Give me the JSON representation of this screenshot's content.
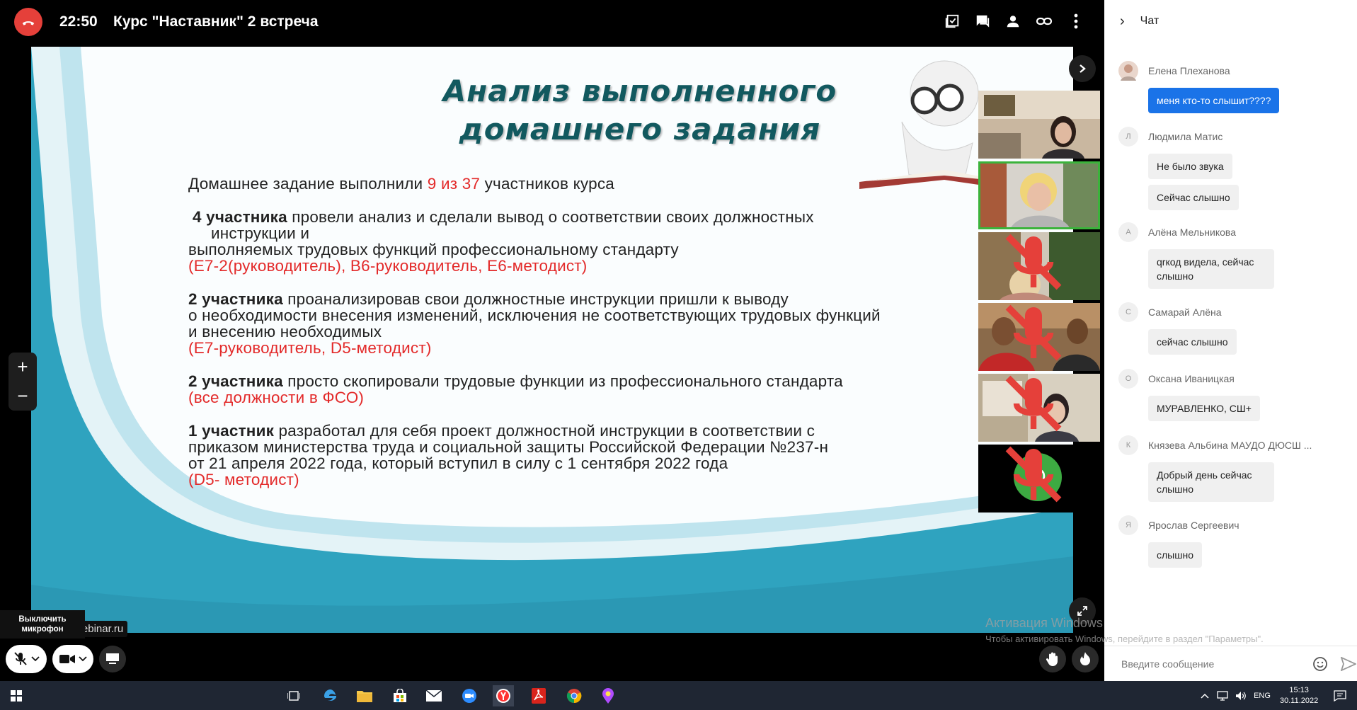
{
  "topbar": {
    "time": "22:50",
    "title": "Курс \"Наставник\" 2 встреча"
  },
  "slide": {
    "title_line1": "Анализ выполненного",
    "title_line2": "домашнего задания",
    "p1_text_a": "Домашнее задание выполнили ",
    "p1_count": "9",
    "p1_of": " из ",
    "p1_total": "37",
    "p1_text_b": " участников курса",
    "p2_bold": "4 участника",
    "p2_line1": " провели анализ  и сделали вывод о соответствии своих должностных",
    "p2_line2": "инструкции  и",
    "p2_line3": "выполняемых трудовых функций  профессиональному стандарту",
    "p2_red": "(Е7-2(руководитель), В6-руководитель, Е6-методист)",
    "p3_bold": "2 участника",
    "p3_line1": " проанализировав свои должностные инструкции пришли к выводу",
    "p3_line2": "о необходимости внесения изменений, исключения не соответствующих трудовых функций",
    "p3_line3": "и внесению необходимых",
    "p3_red": "(Е7-руководитель, D5-методист)",
    "p4_bold": "2 участника",
    "p4_line1": " просто скопировали трудовые функции из профессионального стандарта",
    "p4_red": "(все должности  в ФСО)",
    "p5_bold": "1 участник",
    "p5_line1": " разработал для себя  проект должностной инструкции  в соответствии с",
    "p5_line2": "приказом министерства труда и социальной защиты Российской Федерации №237-н",
    "p5_line3": "от 21 апреля 2022 года, который вступил в силу с 1 сентября 2022 года",
    "p5_red": "(D5- методист)"
  },
  "participants": {
    "avatar_letter": "О"
  },
  "controls": {
    "tooltip_line1": "Выключить",
    "tooltip_line2": "микрофон",
    "brand": "Webinar.ru"
  },
  "chat": {
    "title": "Чат",
    "messages": [
      {
        "initial": "",
        "author": "Елена Плеханова",
        "texts": [
          "меня кто-то слышит????"
        ]
      },
      {
        "initial": "Л",
        "author": "Людмила Матис",
        "texts": [
          "Не было звука",
          "Сейчас слышно"
        ]
      },
      {
        "initial": "А",
        "author": "Алёна Мельникова",
        "texts": [
          "qrкод видела, сейчас слышно"
        ]
      },
      {
        "initial": "С",
        "author": "Самарай Алёна",
        "texts": [
          "сейчас слышно"
        ]
      },
      {
        "initial": "О",
        "author": "Оксана Иваницкая",
        "texts": [
          "МУРАВЛЕНКО, СШ+"
        ]
      },
      {
        "initial": "К",
        "author": "Князева Альбина МАУДО ДЮСШ ...",
        "texts": [
          "Добрый день сейчас слышно"
        ]
      },
      {
        "initial": "Я",
        "author": "Ярослав Сергеевич",
        "texts": [
          "слышно"
        ]
      }
    ],
    "input_placeholder": "Введите сообщение"
  },
  "activation": {
    "line1": "Активация Windows",
    "line2": "Чтобы активировать Windows, перейдите в раздел \"Параметры\"."
  },
  "taskbar": {
    "lang": "ENG",
    "time": "15:13",
    "date": "30.11.2022"
  }
}
